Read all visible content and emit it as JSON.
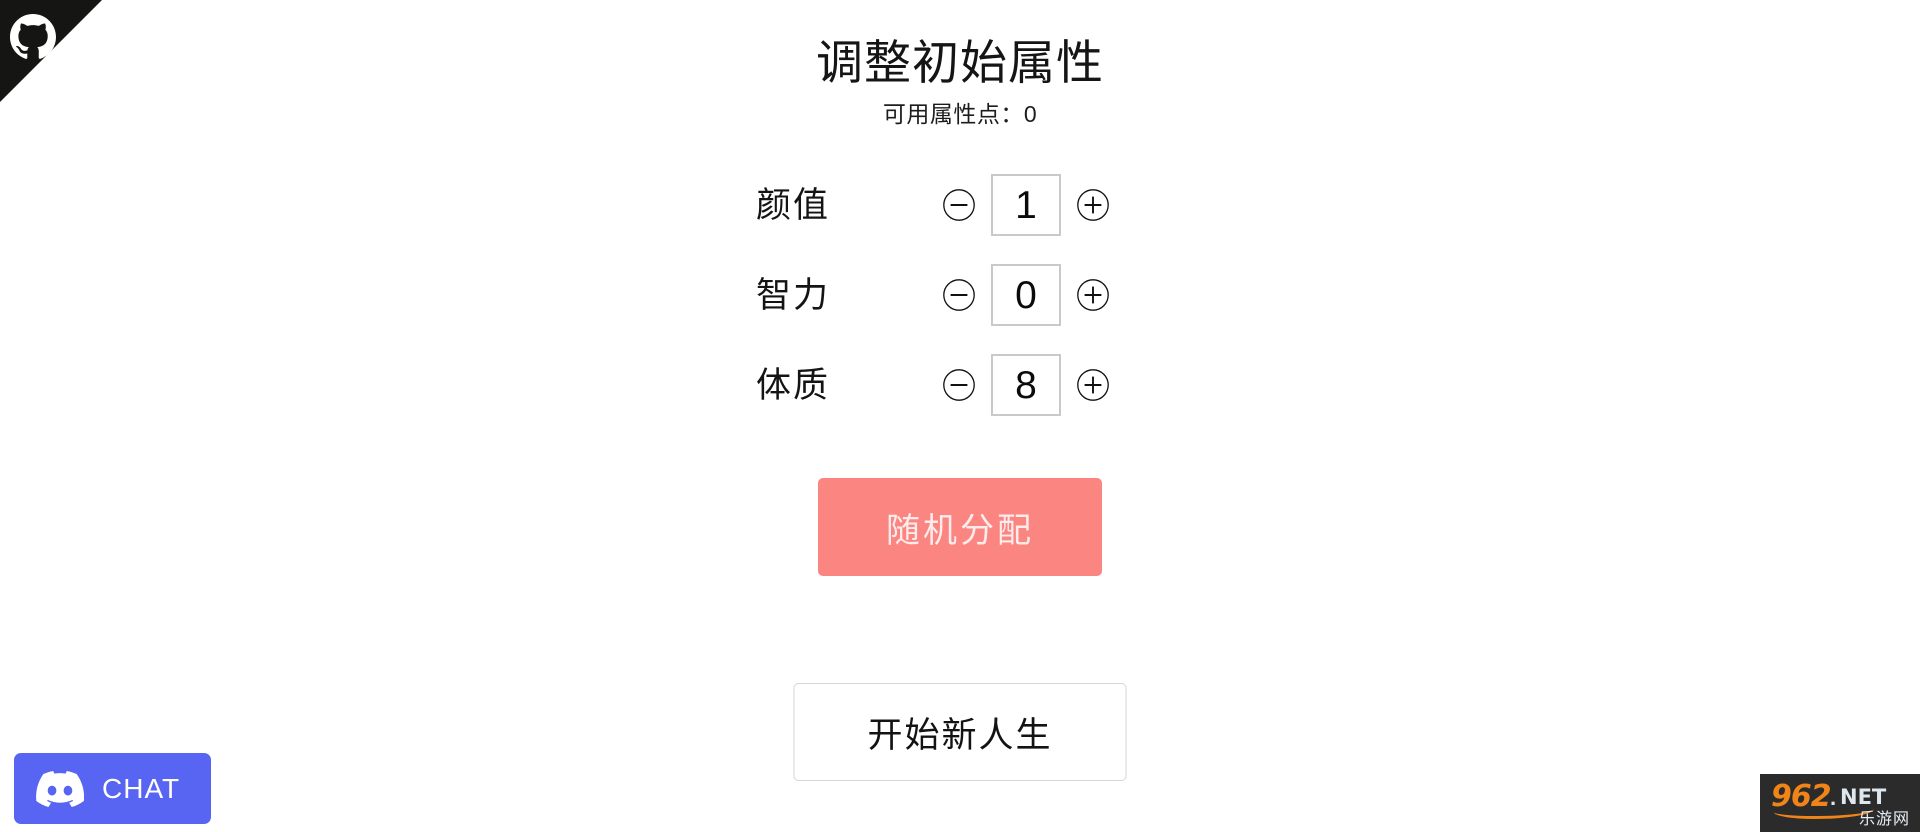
{
  "page": {
    "title": "调整初始属性",
    "points_label": "可用属性点：0",
    "background_color": "#ffffff"
  },
  "corner_ribbon": {
    "name": "fork-me-on-github",
    "icon": "octocat-icon",
    "background_color": "#151513",
    "icon_color": "#ffffff"
  },
  "attributes": [
    {
      "label": "颜值",
      "value": "1",
      "decrement_icon": "circle-minus-icon",
      "increment_icon": "circle-plus-icon"
    },
    {
      "label": "智力",
      "value": "0",
      "decrement_icon": "circle-minus-icon",
      "increment_icon": "circle-plus-icon"
    },
    {
      "label": "体质",
      "value": "8",
      "decrement_icon": "circle-minus-icon",
      "increment_icon": "circle-plus-icon"
    }
  ],
  "buttons": {
    "random_label": "随机分配",
    "random_bg_color": "#fa8581",
    "random_text_color": "#fdeceb",
    "start_label": "开始新人生",
    "start_bg_color": "#ffffff",
    "start_border_color": "#d6d6d6",
    "start_text_color": "#131313"
  },
  "discord_widget": {
    "label": "CHAT",
    "icon": "discord-icon",
    "background_color": "#5865f2",
    "text_color": "#ffffff"
  },
  "watermark": {
    "number": "962",
    "dot": ".",
    "net": "NET",
    "chinese": "乐游网",
    "background_color": "#2b2b2b",
    "accent_color": "#f08419",
    "text_color": "#dfe7ee"
  }
}
